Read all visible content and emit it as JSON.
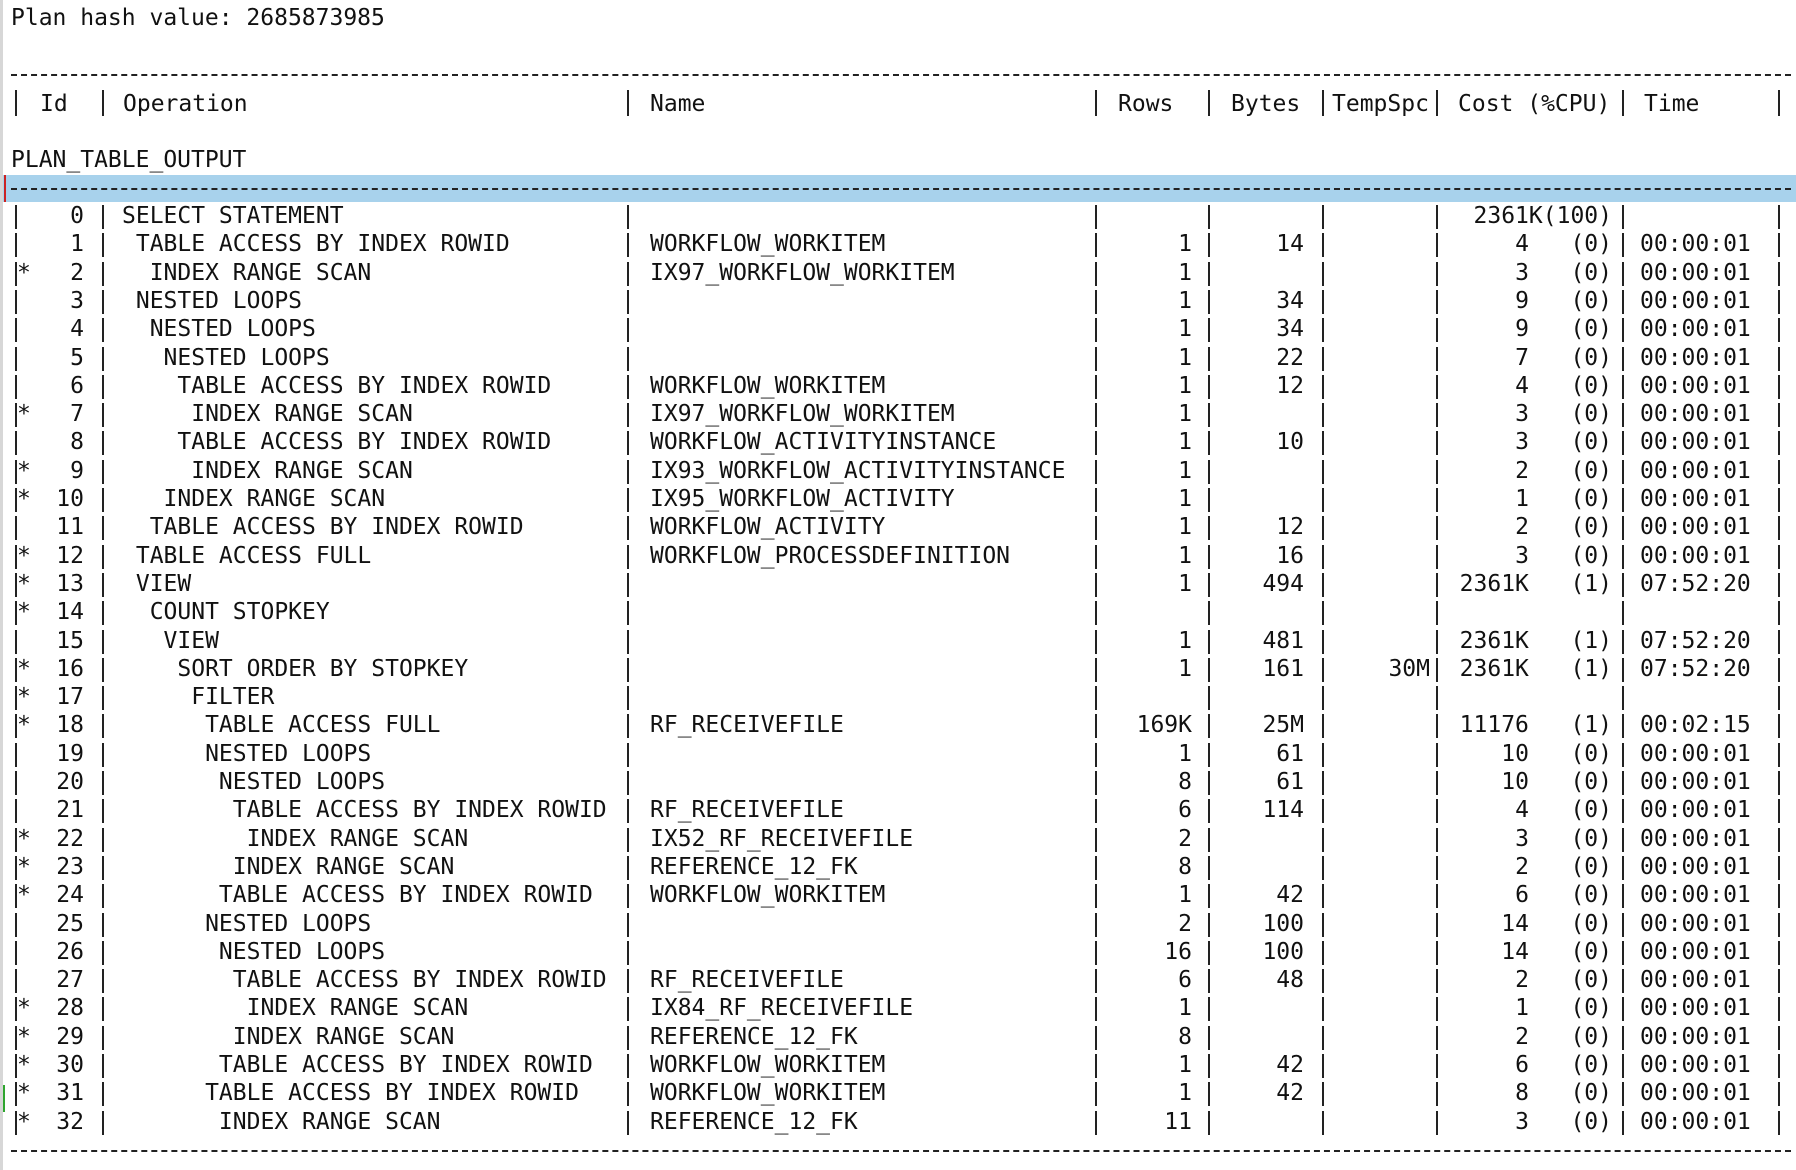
{
  "plan_hash_line": "Plan hash value: 2685873985",
  "plan_table_output_label": "PLAN_TABLE_OUTPUT",
  "header": {
    "id": "Id",
    "operation": "Operation",
    "name": "Name",
    "rows": "Rows",
    "bytes": "Bytes",
    "tempspc": "TempSpc",
    "cost": "Cost (%CPU)",
    "time": "Time"
  },
  "rows": [
    {
      "pred": "",
      "id": "0",
      "operation": "SELECT STATEMENT",
      "name": "",
      "rows": "",
      "bytes": "",
      "tempspc": "",
      "cost": "2361K(100)",
      "time": ""
    },
    {
      "pred": "",
      "id": "1",
      "operation": " TABLE ACCESS BY INDEX ROWID",
      "name": "WORKFLOW_WORKITEM",
      "rows": "1",
      "bytes": "14",
      "tempspc": "",
      "cost": "4   (0)",
      "time": "00:00:01"
    },
    {
      "pred": "*",
      "id": "2",
      "operation": "  INDEX RANGE SCAN",
      "name": "IX97_WORKFLOW_WORKITEM",
      "rows": "1",
      "bytes": "",
      "tempspc": "",
      "cost": "3   (0)",
      "time": "00:00:01"
    },
    {
      "pred": "",
      "id": "3",
      "operation": " NESTED LOOPS",
      "name": "",
      "rows": "1",
      "bytes": "34",
      "tempspc": "",
      "cost": "9   (0)",
      "time": "00:00:01"
    },
    {
      "pred": "",
      "id": "4",
      "operation": "  NESTED LOOPS",
      "name": "",
      "rows": "1",
      "bytes": "34",
      "tempspc": "",
      "cost": "9   (0)",
      "time": "00:00:01"
    },
    {
      "pred": "",
      "id": "5",
      "operation": "   NESTED LOOPS",
      "name": "",
      "rows": "1",
      "bytes": "22",
      "tempspc": "",
      "cost": "7   (0)",
      "time": "00:00:01"
    },
    {
      "pred": "",
      "id": "6",
      "operation": "    TABLE ACCESS BY INDEX ROWID",
      "name": "WORKFLOW_WORKITEM",
      "rows": "1",
      "bytes": "12",
      "tempspc": "",
      "cost": "4   (0)",
      "time": "00:00:01"
    },
    {
      "pred": "*",
      "id": "7",
      "operation": "     INDEX RANGE SCAN",
      "name": "IX97_WORKFLOW_WORKITEM",
      "rows": "1",
      "bytes": "",
      "tempspc": "",
      "cost": "3   (0)",
      "time": "00:00:01"
    },
    {
      "pred": "",
      "id": "8",
      "operation": "    TABLE ACCESS BY INDEX ROWID",
      "name": "WORKFLOW_ACTIVITYINSTANCE",
      "rows": "1",
      "bytes": "10",
      "tempspc": "",
      "cost": "3   (0)",
      "time": "00:00:01"
    },
    {
      "pred": "*",
      "id": "9",
      "operation": "     INDEX RANGE SCAN",
      "name": "IX93_WORKFLOW_ACTIVITYINSTANCE",
      "rows": "1",
      "bytes": "",
      "tempspc": "",
      "cost": "2   (0)",
      "time": "00:00:01"
    },
    {
      "pred": "*",
      "id": "10",
      "operation": "   INDEX RANGE SCAN",
      "name": "IX95_WORKFLOW_ACTIVITY",
      "rows": "1",
      "bytes": "",
      "tempspc": "",
      "cost": "1   (0)",
      "time": "00:00:01"
    },
    {
      "pred": "",
      "id": "11",
      "operation": "  TABLE ACCESS BY INDEX ROWID",
      "name": "WORKFLOW_ACTIVITY",
      "rows": "1",
      "bytes": "12",
      "tempspc": "",
      "cost": "2   (0)",
      "time": "00:00:01"
    },
    {
      "pred": "*",
      "id": "12",
      "operation": " TABLE ACCESS FULL",
      "name": "WORKFLOW_PROCESSDEFINITION",
      "rows": "1",
      "bytes": "16",
      "tempspc": "",
      "cost": "3   (0)",
      "time": "00:00:01"
    },
    {
      "pred": "*",
      "id": "13",
      "operation": " VIEW",
      "name": "",
      "rows": "1",
      "bytes": "494",
      "tempspc": "",
      "cost": "2361K   (1)",
      "time": "07:52:20"
    },
    {
      "pred": "*",
      "id": "14",
      "operation": "  COUNT STOPKEY",
      "name": "",
      "rows": "",
      "bytes": "",
      "tempspc": "",
      "cost": "",
      "time": ""
    },
    {
      "pred": "",
      "id": "15",
      "operation": "   VIEW",
      "name": "",
      "rows": "1",
      "bytes": "481",
      "tempspc": "",
      "cost": "2361K   (1)",
      "time": "07:52:20"
    },
    {
      "pred": "*",
      "id": "16",
      "operation": "    SORT ORDER BY STOPKEY",
      "name": "",
      "rows": "1",
      "bytes": "161",
      "tempspc": "30M",
      "cost": "2361K   (1)",
      "time": "07:52:20"
    },
    {
      "pred": "*",
      "id": "17",
      "operation": "     FILTER",
      "name": "",
      "rows": "",
      "bytes": "",
      "tempspc": "",
      "cost": "",
      "time": ""
    },
    {
      "pred": "*",
      "id": "18",
      "operation": "      TABLE ACCESS FULL",
      "name": "RF_RECEIVEFILE",
      "rows": "169K",
      "bytes": "25M",
      "tempspc": "",
      "cost": "11176   (1)",
      "time": "00:02:15"
    },
    {
      "pred": "",
      "id": "19",
      "operation": "      NESTED LOOPS",
      "name": "",
      "rows": "1",
      "bytes": "61",
      "tempspc": "",
      "cost": "10   (0)",
      "time": "00:00:01"
    },
    {
      "pred": "",
      "id": "20",
      "operation": "       NESTED LOOPS",
      "name": "",
      "rows": "8",
      "bytes": "61",
      "tempspc": "",
      "cost": "10   (0)",
      "time": "00:00:01"
    },
    {
      "pred": "",
      "id": "21",
      "operation": "        TABLE ACCESS BY INDEX ROWID",
      "name": "RF_RECEIVEFILE",
      "rows": "6",
      "bytes": "114",
      "tempspc": "",
      "cost": "4   (0)",
      "time": "00:00:01"
    },
    {
      "pred": "*",
      "id": "22",
      "operation": "         INDEX RANGE SCAN",
      "name": "IX52_RF_RECEIVEFILE",
      "rows": "2",
      "bytes": "",
      "tempspc": "",
      "cost": "3   (0)",
      "time": "00:00:01"
    },
    {
      "pred": "*",
      "id": "23",
      "operation": "        INDEX RANGE SCAN",
      "name": "REFERENCE_12_FK",
      "rows": "8",
      "bytes": "",
      "tempspc": "",
      "cost": "2   (0)",
      "time": "00:00:01"
    },
    {
      "pred": "*",
      "id": "24",
      "operation": "       TABLE ACCESS BY INDEX ROWID",
      "name": "WORKFLOW_WORKITEM",
      "rows": "1",
      "bytes": "42",
      "tempspc": "",
      "cost": "6   (0)",
      "time": "00:00:01"
    },
    {
      "pred": "",
      "id": "25",
      "operation": "      NESTED LOOPS",
      "name": "",
      "rows": "2",
      "bytes": "100",
      "tempspc": "",
      "cost": "14   (0)",
      "time": "00:00:01"
    },
    {
      "pred": "",
      "id": "26",
      "operation": "       NESTED LOOPS",
      "name": "",
      "rows": "16",
      "bytes": "100",
      "tempspc": "",
      "cost": "14   (0)",
      "time": "00:00:01"
    },
    {
      "pred": "",
      "id": "27",
      "operation": "        TABLE ACCESS BY INDEX ROWID",
      "name": "RF_RECEIVEFILE",
      "rows": "6",
      "bytes": "48",
      "tempspc": "",
      "cost": "2   (0)",
      "time": "00:00:01"
    },
    {
      "pred": "*",
      "id": "28",
      "operation": "         INDEX RANGE SCAN",
      "name": "IX84_RF_RECEIVEFILE",
      "rows": "1",
      "bytes": "",
      "tempspc": "",
      "cost": "1   (0)",
      "time": "00:00:01"
    },
    {
      "pred": "*",
      "id": "29",
      "operation": "        INDEX RANGE SCAN",
      "name": "REFERENCE_12_FK",
      "rows": "8",
      "bytes": "",
      "tempspc": "",
      "cost": "2   (0)",
      "time": "00:00:01"
    },
    {
      "pred": "*",
      "id": "30",
      "operation": "       TABLE ACCESS BY INDEX ROWID",
      "name": "WORKFLOW_WORKITEM",
      "rows": "1",
      "bytes": "42",
      "tempspc": "",
      "cost": "6   (0)",
      "time": "00:00:01"
    },
    {
      "pred": "*",
      "id": "31",
      "operation": "      TABLE ACCESS BY INDEX ROWID",
      "name": "WORKFLOW_WORKITEM",
      "rows": "1",
      "bytes": "42",
      "tempspc": "",
      "cost": "8   (0)",
      "time": "00:00:01"
    },
    {
      "pred": "*",
      "id": "32",
      "operation": "       INDEX RANGE SCAN",
      "name": "REFERENCE_12_FK",
      "rows": "11",
      "bytes": "",
      "tempspc": "",
      "cost": "3   (0)",
      "time": "00:00:01"
    }
  ],
  "colors": {
    "highlight": "#a8d2ec",
    "text": "#111111",
    "cursor": "#cc2222",
    "gutter_mark": "#2fa52f"
  }
}
